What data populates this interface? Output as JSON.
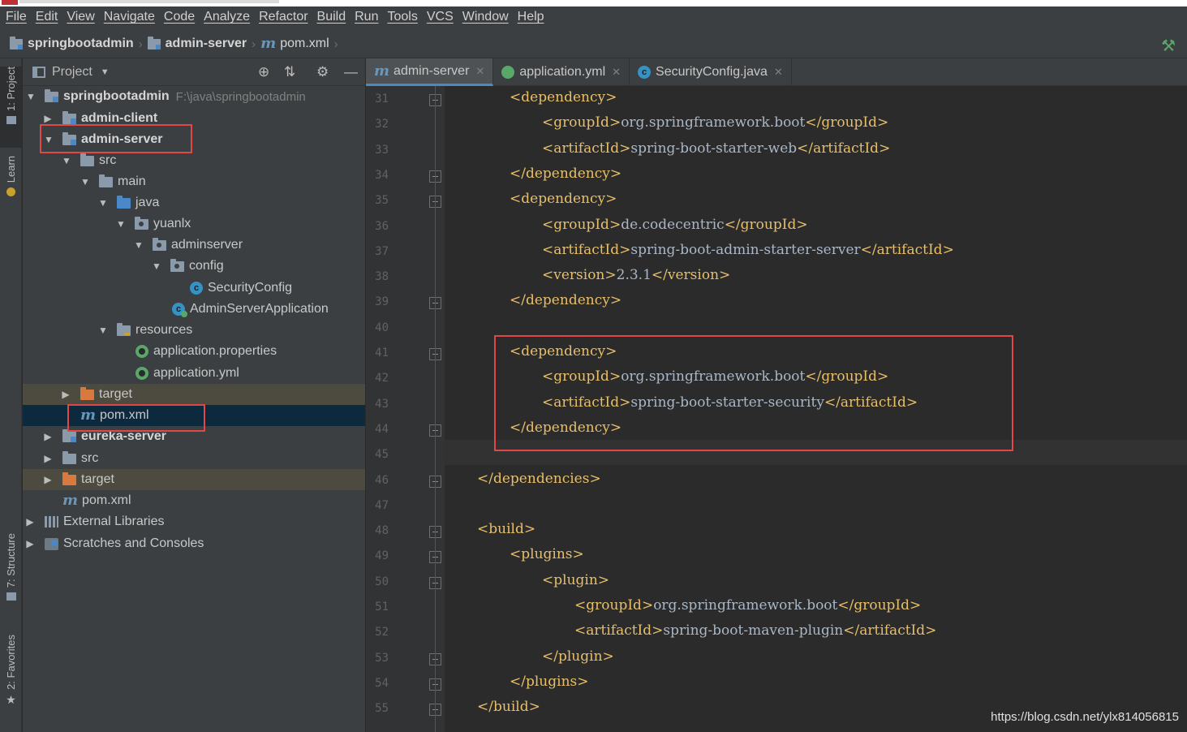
{
  "menu": [
    "File",
    "Edit",
    "View",
    "Navigate",
    "Code",
    "Analyze",
    "Refactor",
    "Build",
    "Run",
    "Tools",
    "VCS",
    "Window",
    "Help"
  ],
  "breadcrumb": {
    "project": "springbootadmin",
    "module": "admin-server",
    "file": "pom.xml"
  },
  "left_strip": {
    "project_tab": "1: Project",
    "learn_tab": "Learn",
    "structure_tab": "7: Structure",
    "favorites_tab": "2: Favorites"
  },
  "project_panel": {
    "title": "Project",
    "tree": [
      {
        "label": "springbootadmin",
        "path": "F:\\java\\springbootadmin"
      },
      {
        "label": "admin-client"
      },
      {
        "label": "admin-server"
      },
      {
        "label": "src"
      },
      {
        "label": "main"
      },
      {
        "label": "java"
      },
      {
        "label": "yuanlx"
      },
      {
        "label": "adminserver"
      },
      {
        "label": "config"
      },
      {
        "label": "SecurityConfig"
      },
      {
        "label": "AdminServerApplication"
      },
      {
        "label": "resources"
      },
      {
        "label": "application.properties"
      },
      {
        "label": "application.yml"
      },
      {
        "label": "target"
      },
      {
        "label": "pom.xml"
      },
      {
        "label": "eureka-server"
      },
      {
        "label": "src"
      },
      {
        "label": "target"
      },
      {
        "label": "pom.xml"
      },
      {
        "label": "External Libraries"
      },
      {
        "label": "Scratches and Consoles"
      }
    ]
  },
  "editor": {
    "tabs": [
      {
        "label": "admin-server"
      },
      {
        "label": "application.yml"
      },
      {
        "label": "SecurityConfig.java"
      }
    ],
    "lines": [
      {
        "n": "31",
        "tag": "dependency",
        "close": false,
        "indent": 2
      },
      {
        "n": "32",
        "tag": "groupId",
        "text": "org.springframework.boot",
        "indent": 3
      },
      {
        "n": "33",
        "tag": "artifactId",
        "text": "spring-boot-starter-web",
        "indent": 3
      },
      {
        "n": "34",
        "tag": "dependency",
        "close": true,
        "indent": 2
      },
      {
        "n": "35",
        "tag": "dependency",
        "close": false,
        "indent": 2
      },
      {
        "n": "36",
        "tag": "groupId",
        "text": "de.codecentric",
        "indent": 3
      },
      {
        "n": "37",
        "tag": "artifactId",
        "text": "spring-boot-admin-starter-server",
        "indent": 3
      },
      {
        "n": "38",
        "tag": "version",
        "text": "2.3.1",
        "indent": 3
      },
      {
        "n": "39",
        "tag": "dependency",
        "close": true,
        "indent": 2
      },
      {
        "n": "40"
      },
      {
        "n": "41",
        "tag": "dependency",
        "close": false,
        "indent": 2
      },
      {
        "n": "42",
        "tag": "groupId",
        "text": "org.springframework.boot",
        "indent": 3
      },
      {
        "n": "43",
        "tag": "artifactId",
        "text": "spring-boot-starter-security",
        "indent": 3
      },
      {
        "n": "44",
        "tag": "dependency",
        "close": true,
        "indent": 2
      },
      {
        "n": "45"
      },
      {
        "n": "46",
        "tag": "dependencies",
        "close": true,
        "indent": 1
      },
      {
        "n": "47"
      },
      {
        "n": "48",
        "tag": "build",
        "close": false,
        "indent": 1
      },
      {
        "n": "49",
        "tag": "plugins",
        "close": false,
        "indent": 2
      },
      {
        "n": "50",
        "tag": "plugin",
        "close": false,
        "indent": 3
      },
      {
        "n": "51",
        "tag": "groupId",
        "text": "org.springframework.boot",
        "indent": 4
      },
      {
        "n": "52",
        "tag": "artifactId",
        "text": "spring-boot-maven-plugin",
        "indent": 4
      },
      {
        "n": "53",
        "tag": "plugin",
        "close": true,
        "indent": 3
      },
      {
        "n": "54",
        "tag": "plugins",
        "close": true,
        "indent": 2
      },
      {
        "n": "55",
        "tag": "build",
        "close": true,
        "indent": 1
      }
    ]
  },
  "watermark": "https://blog.csdn.net/ylx814056815"
}
